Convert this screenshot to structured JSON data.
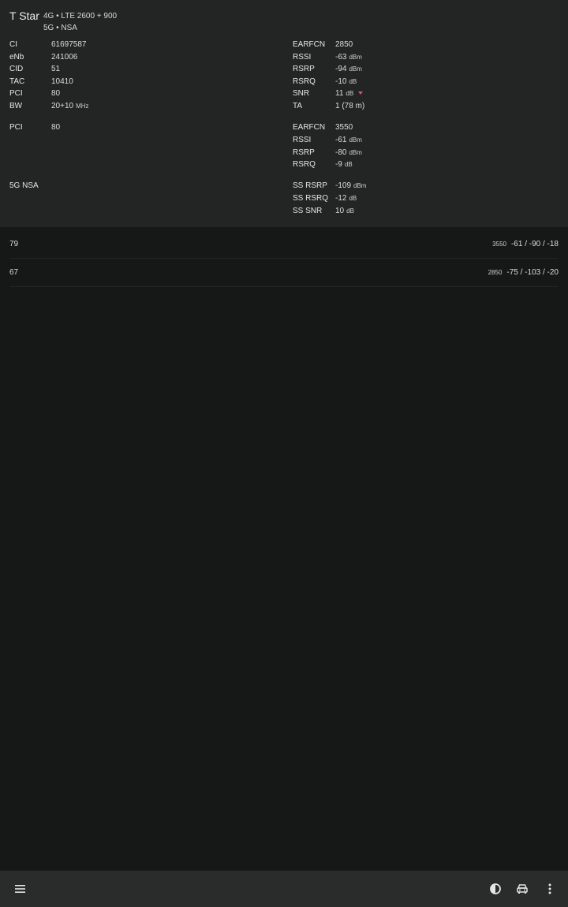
{
  "header": {
    "operator": "T Star",
    "tech_line1": "4G • LTE 2600 + 900",
    "tech_line2": "5G • NSA"
  },
  "lte_primary": {
    "left": [
      {
        "label": "CI",
        "value": "61697587"
      },
      {
        "label": "eNb",
        "value": "241006"
      },
      {
        "label": "CID",
        "value": "51"
      },
      {
        "label": "TAC",
        "value": "10410"
      },
      {
        "label": "PCI",
        "value": "80"
      },
      {
        "label": "BW",
        "value": "20+10",
        "unit": "MHz"
      }
    ],
    "right": [
      {
        "label": "EARFCN",
        "value": "2850"
      },
      {
        "label": "RSSI",
        "value": "-63",
        "unit": "dBm"
      },
      {
        "label": "RSRP",
        "value": "-94",
        "unit": "dBm"
      },
      {
        "label": "RSRQ",
        "value": "-10",
        "unit": "dB"
      },
      {
        "label": "SNR",
        "value": "11",
        "unit": "dB",
        "trend": "down"
      },
      {
        "label": "TA",
        "value": "1 (78 m)"
      }
    ]
  },
  "lte_secondary": {
    "left": [
      {
        "label": "PCI",
        "value": "80"
      }
    ],
    "right": [
      {
        "label": "EARFCN",
        "value": "3550"
      },
      {
        "label": "RSSI",
        "value": "-61",
        "unit": "dBm"
      },
      {
        "label": "RSRP",
        "value": "-80",
        "unit": "dBm"
      },
      {
        "label": "RSRQ",
        "value": "-9",
        "unit": "dB"
      }
    ]
  },
  "nr": {
    "label": "5G NSA",
    "right": [
      {
        "label": "SS RSRP",
        "value": "-109",
        "unit": "dBm"
      },
      {
        "label": "SS RSRQ",
        "value": "-12",
        "unit": "dB"
      },
      {
        "label": "SS SNR",
        "value": "10",
        "unit": "dB"
      }
    ]
  },
  "neighbors": [
    {
      "pci": "79",
      "freq": "3550",
      "values": "-61 / -90 / -18"
    },
    {
      "pci": "67",
      "freq": "2850",
      "values": "-75 / -103 / -20"
    }
  ],
  "toolbar": {
    "menu_icon": "menu-icon",
    "contrast_icon": "contrast-icon",
    "car_icon": "car-icon",
    "more_icon": "more-vertical-icon"
  },
  "colors": {
    "background": "#161717",
    "panel": "#232424",
    "bottom_bar": "#2a2b2b",
    "trend_down": "#e0506f"
  }
}
